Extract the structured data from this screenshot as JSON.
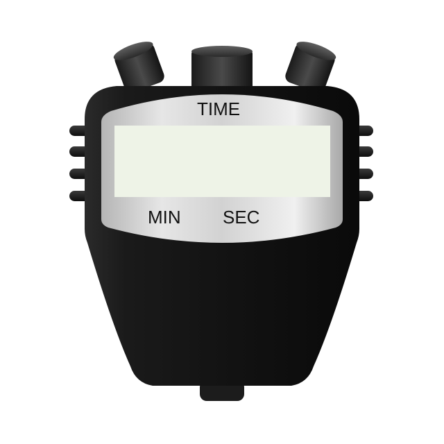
{
  "display": {
    "top_label": "TIME",
    "left_label": "MIN",
    "right_label": "SEC"
  },
  "colors": {
    "body": "#151515",
    "lcd": "#eef3e7",
    "bezel": "#cfcfcf"
  }
}
